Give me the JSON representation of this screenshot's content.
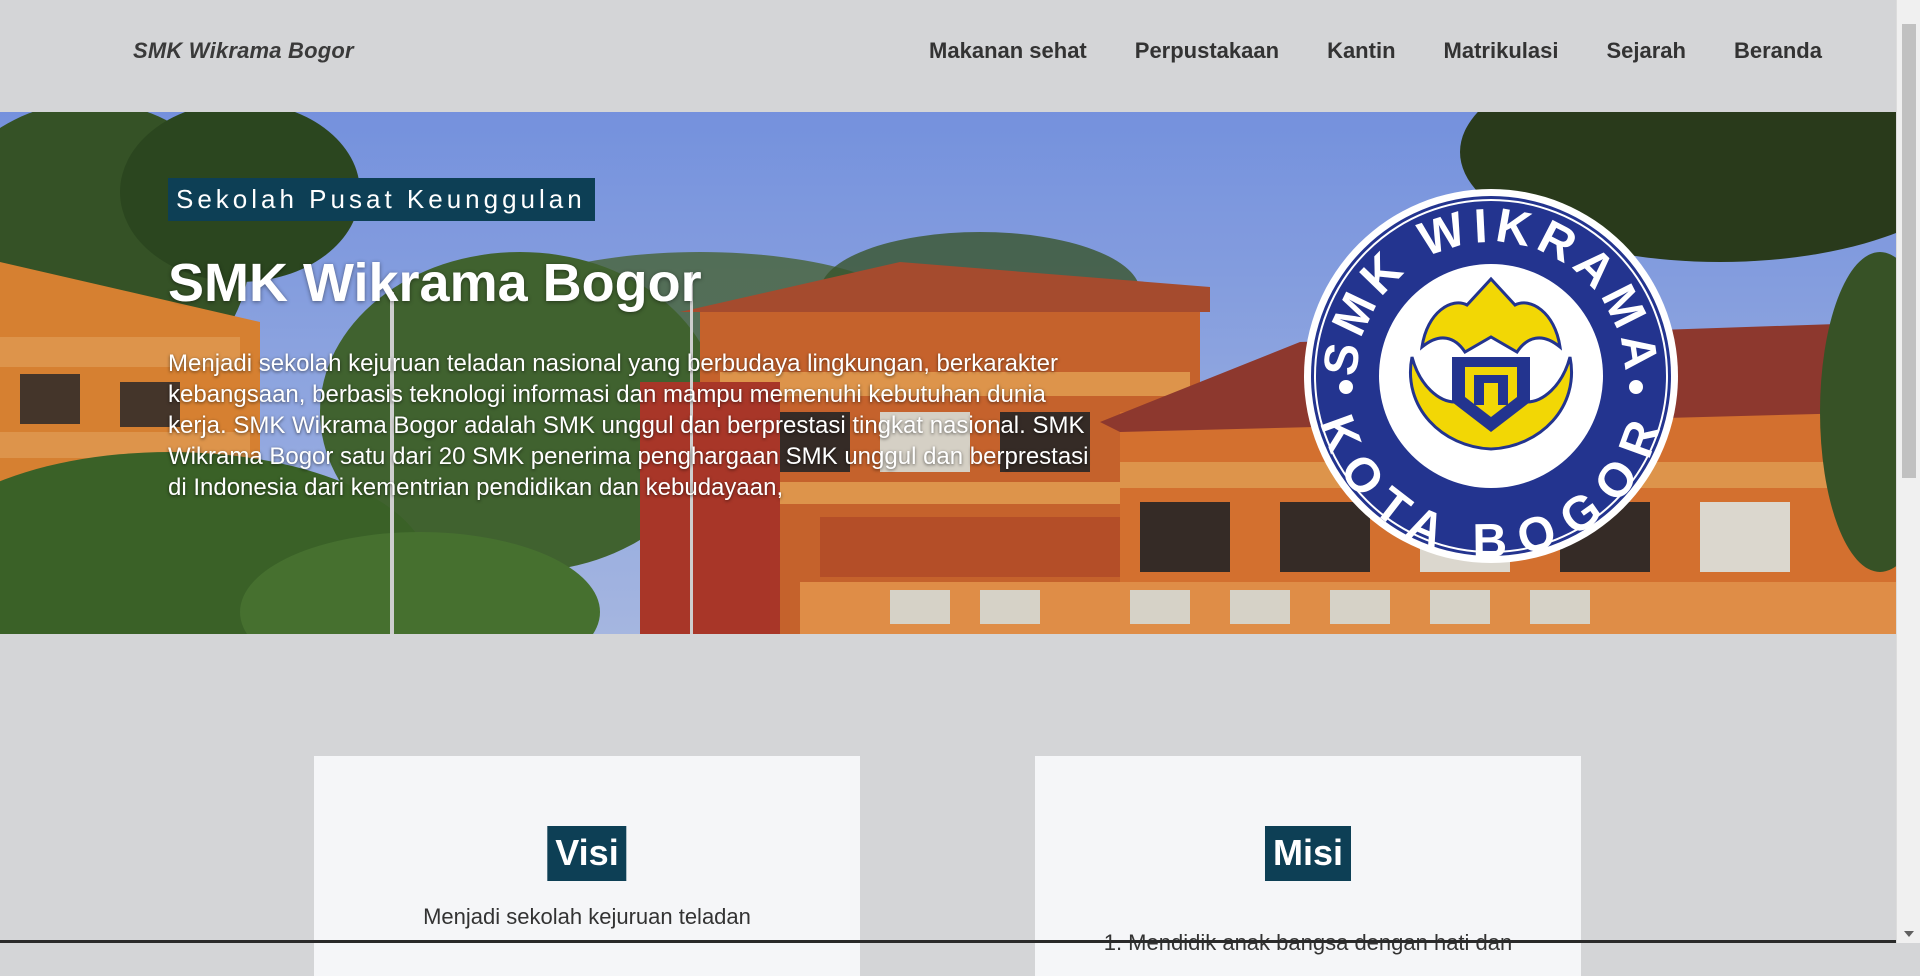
{
  "navbar": {
    "brand": "SMK Wikrama Bogor",
    "links": [
      "Makanan sehat",
      "Perpustakaan",
      "Kantin",
      "Matrikulasi",
      "Sejarah",
      "Beranda"
    ]
  },
  "hero": {
    "tag": "Sekolah Pusat Keunggulan",
    "title": "SMK Wikrama Bogor",
    "description": "Menjadi sekolah kejuruan teladan nasional yang berbudaya lingkungan, berkarakter kebangsaan, berbasis teknologi informasi dan mampu memenuhi kebutuhan dunia kerja. SMK Wikrama Bogor adalah SMK unggul dan berprestasi tingkat nasional. SMK Wikrama Bogor satu dari 20 SMK penerima penghargaan SMK unggul dan berprestasi di Indonesia dari kementrian pendidikan dan kebudayaan,",
    "logo": {
      "top_text": "SMK WIKRAMA",
      "bottom_text": "KOTA BOGOR"
    }
  },
  "cards": {
    "visi": {
      "heading": "Visi",
      "text": "Menjadi sekolah kejuruan teladan"
    },
    "misi": {
      "heading": "Misi",
      "text": "1. Mendidik anak bangsa dengan hati dan"
    }
  },
  "colors": {
    "page_bg": "#d4d5d7",
    "accent": "#0d3f55",
    "logo_blue": "#23348f",
    "logo_yellow": "#f2d705",
    "card_bg": "#f5f6f8"
  }
}
